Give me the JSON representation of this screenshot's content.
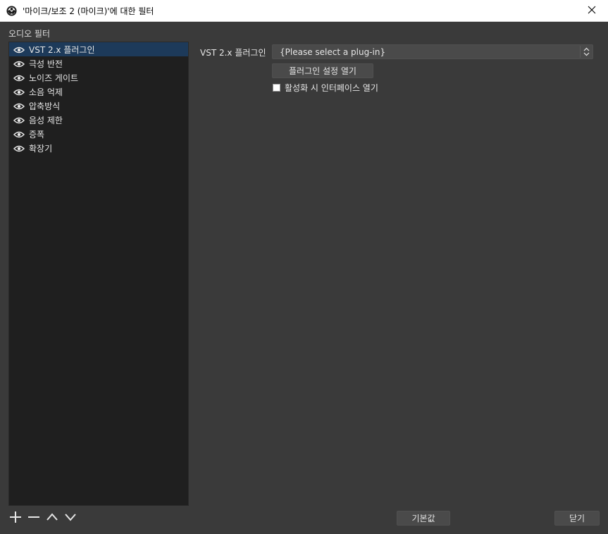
{
  "window": {
    "title": "'마이크/보조 2 (마이크)'에 대한 필터"
  },
  "filters_panel": {
    "label": "오디오 필터",
    "items": [
      {
        "label": "VST 2.x 플러그인",
        "selected": true
      },
      {
        "label": "극성 반전"
      },
      {
        "label": "노이즈 게이트"
      },
      {
        "label": "소음 억제"
      },
      {
        "label": "압축방식"
      },
      {
        "label": "음성 제한"
      },
      {
        "label": "증폭"
      },
      {
        "label": "확장기"
      }
    ]
  },
  "properties": {
    "plugin_label": "VST 2.x 플러그인",
    "plugin_value": "{Please select a plug-in}",
    "open_settings_label": "플러그인 설정 열기",
    "open_on_activate_label": "활성화 시 인터페이스 열기"
  },
  "footer": {
    "defaults_label": "기본값",
    "close_label": "닫기"
  },
  "icons": {
    "app": "obs-logo-icon",
    "close": "close-icon",
    "visibility": "eye-icon",
    "add": "plus-icon",
    "remove": "minus-icon",
    "move_up": "chevron-up-icon",
    "move_down": "chevron-down-icon"
  },
  "colors": {
    "window_bg": "#3a3a3a",
    "list_bg": "#1f1f1f",
    "selected_bg": "#1d3a5a",
    "control_bg": "#4a4a4a",
    "titlebar_bg": "#ffffff"
  }
}
